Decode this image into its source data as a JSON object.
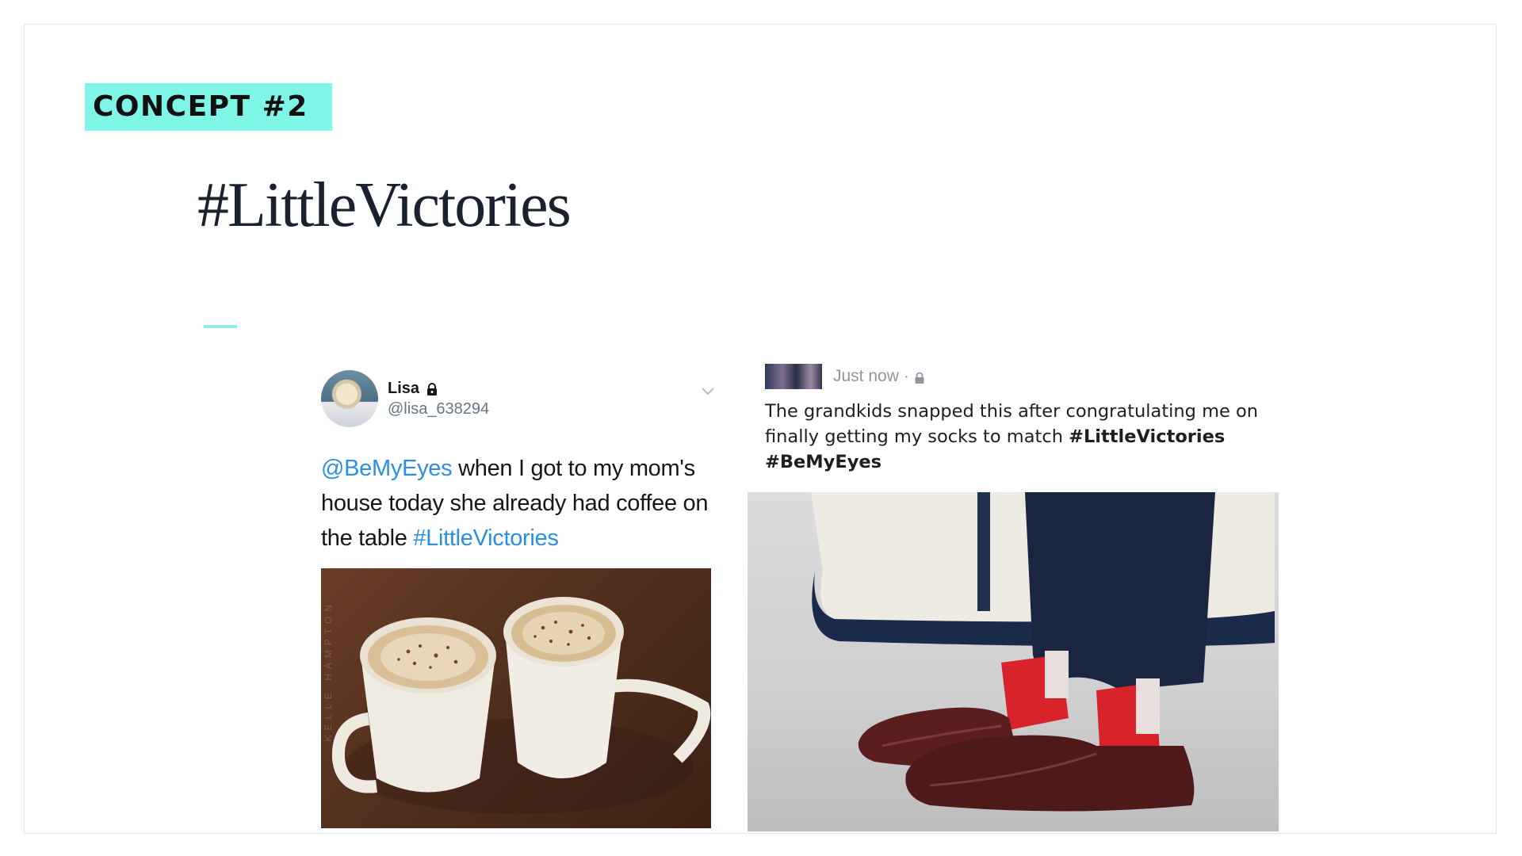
{
  "slide": {
    "badge": "CONCEPT #2",
    "title": "#LittleVictories"
  },
  "colors": {
    "badge_bg": "#7ff5e6",
    "accent_line": "#8ceee4",
    "link_blue": "#2b8fe0",
    "title_text": "#1a2230"
  },
  "tweet": {
    "name": "Lisa",
    "handle": "@lisa_638294",
    "text_parts": [
      "@BeMyEyes",
      " when I got to my mom's house today she already had coffee on the table ",
      "#LittleVictories"
    ],
    "photo_watermark": "KELLE HAMPTON",
    "icons": {
      "protected": "lock-icon",
      "menu": "chevron-down-icon"
    }
  },
  "post": {
    "time": "Just now",
    "separator": "·",
    "text": "The grandkids snapped this after congratulating me on finally getting my socks to match ",
    "hashtag1": "#LittleVictories",
    "hashtag2": "#BeMyEyes",
    "icons": {
      "audience": "lock-icon"
    }
  }
}
